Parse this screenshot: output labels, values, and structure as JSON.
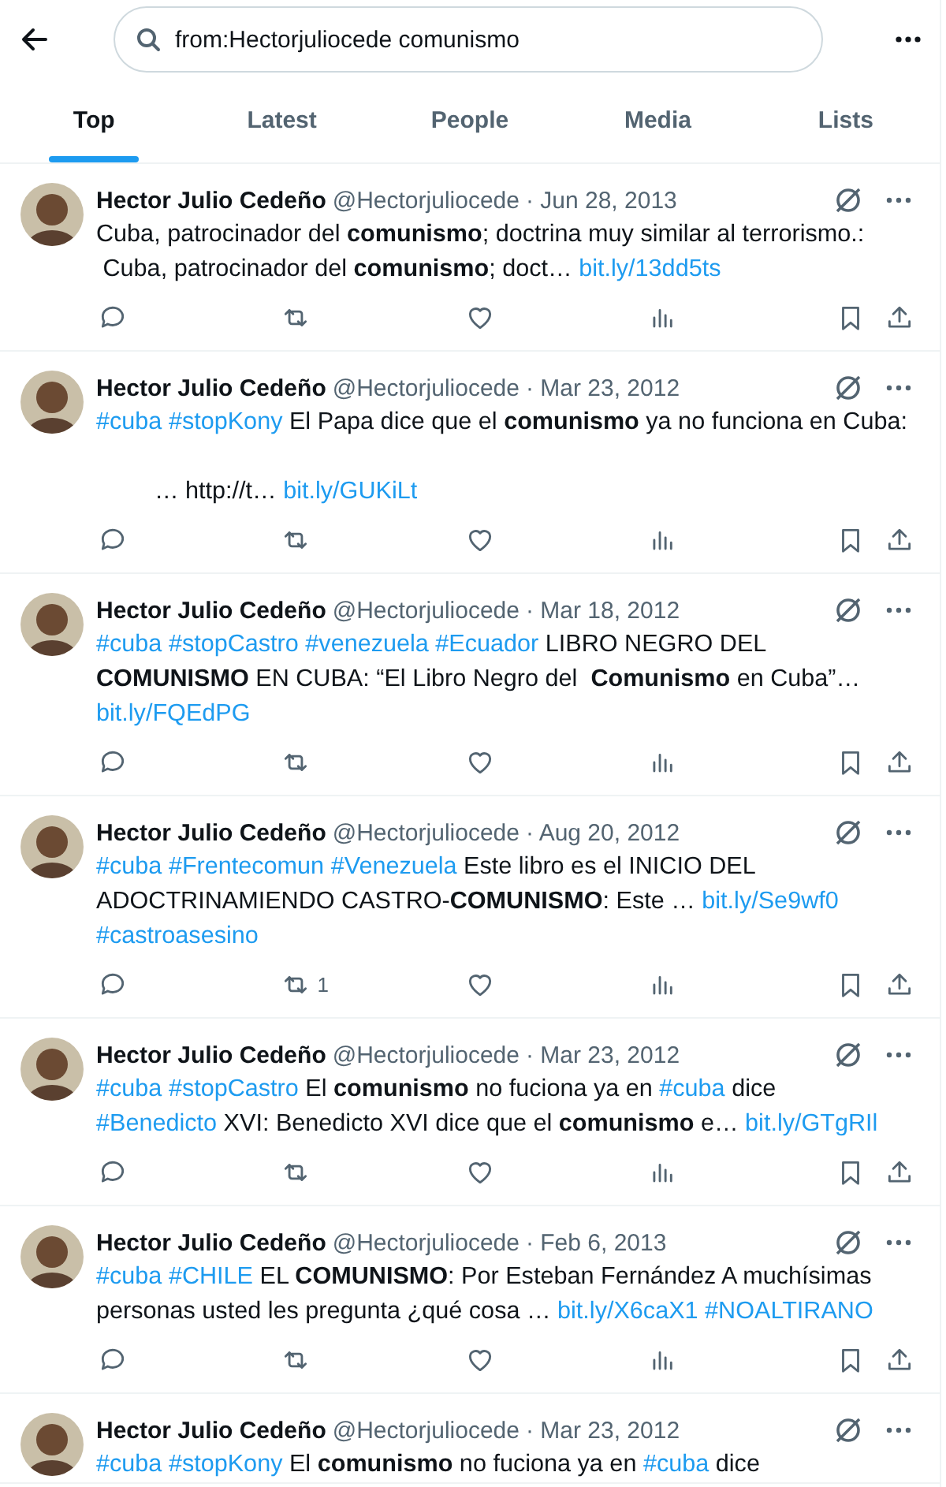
{
  "search": {
    "value": "from:Hectorjuliocede comunismo"
  },
  "tabs": [
    {
      "label": "Top",
      "selected": true
    },
    {
      "label": "Latest",
      "selected": false
    },
    {
      "label": "People",
      "selected": false
    },
    {
      "label": "Media",
      "selected": false
    },
    {
      "label": "Lists",
      "selected": false
    }
  ],
  "tweets": [
    {
      "name": "Hector Julio Cedeño",
      "handle": "@Hectorjuliocede",
      "date": "· Jun 28, 2013",
      "lines": [
        {
          "segments": [
            {
              "kind": "text",
              "text": "Cuba, patrocinador del "
            },
            {
              "kind": "bold",
              "text": "comunismo"
            },
            {
              "kind": "text",
              "text": "; doctrina muy similar al terrorismo.:"
            }
          ]
        },
        {
          "segments": [
            {
              "kind": "text",
              "text": " Cuba, patrocinador del "
            },
            {
              "kind": "bold",
              "text": "comunismo"
            },
            {
              "kind": "text",
              "text": "; doct… "
            },
            {
              "kind": "link",
              "text": "bit.ly/13dd5ts"
            }
          ]
        }
      ]
    },
    {
      "name": "Hector Julio Cedeño",
      "handle": "@Hectorjuliocede",
      "date": "· Mar 23, 2012",
      "lines": [
        {
          "segments": [
            {
              "kind": "link",
              "text": "#cuba"
            },
            {
              "kind": "link",
              "text": "#stopKony"
            },
            {
              "kind": "text",
              "text": " El Papa dice que el "
            },
            {
              "kind": "bold",
              "text": "comunismo"
            },
            {
              "kind": "text",
              "text": " ya no funciona en Cuba:"
            }
          ]
        },
        {
          "gap_before": true,
          "indent": true,
          "segments": [
            {
              "kind": "text",
              "text": "… http://t… "
            },
            {
              "kind": "link",
              "text": "bit.ly/GUKiLt"
            }
          ]
        }
      ]
    },
    {
      "name": "Hector Julio Cedeño",
      "handle": "@Hectorjuliocede",
      "date": "· Mar 18, 2012",
      "lines": [
        {
          "segments": [
            {
              "kind": "link",
              "text": "#cuba"
            },
            {
              "kind": "link",
              "text": "#stopCastro"
            },
            {
              "kind": "link",
              "text": "#venezuela"
            },
            {
              "kind": "link",
              "text": "#Ecuador"
            },
            {
              "kind": "text",
              "text": " LIBRO NEGRO DEL"
            }
          ]
        },
        {
          "segments": [
            {
              "kind": "bold",
              "text": "COMUNISMO"
            },
            {
              "kind": "text",
              "text": " EN CUBA: “El Libro Negro del  "
            },
            {
              "kind": "bold",
              "text": "Comunismo"
            },
            {
              "kind": "text",
              "text": " en Cuba”…"
            }
          ]
        },
        {
          "segments": [
            {
              "kind": "link",
              "text": "bit.ly/FQEdPG"
            }
          ]
        }
      ]
    },
    {
      "name": "Hector Julio Cedeño",
      "handle": "@Hectorjuliocede",
      "date": "· Aug 20, 2012",
      "lines": [
        {
          "segments": [
            {
              "kind": "link",
              "text": "#cuba"
            },
            {
              "kind": "link",
              "text": "#Frentecomun"
            },
            {
              "kind": "link",
              "text": "#Venezuela"
            },
            {
              "kind": "text",
              "text": " Este libro es el INICIO DEL"
            }
          ]
        },
        {
          "segments": [
            {
              "kind": "text",
              "text": "ADOCTRINAMIENDO CASTRO-"
            },
            {
              "kind": "bold",
              "text": "COMUNISMO"
            },
            {
              "kind": "text",
              "text": ": Este … "
            },
            {
              "kind": "link",
              "text": "bit.ly/Se9wf0"
            }
          ]
        },
        {
          "segments": [
            {
              "kind": "link",
              "text": "#castroasesino"
            }
          ]
        }
      ],
      "retweets": "1"
    },
    {
      "name": "Hector Julio Cedeño",
      "handle": "@Hectorjuliocede",
      "date": "· Mar 23, 2012",
      "lines": [
        {
          "segments": [
            {
              "kind": "link",
              "text": "#cuba"
            },
            {
              "kind": "link",
              "text": "#stopCastro"
            },
            {
              "kind": "text",
              "text": " El "
            },
            {
              "kind": "bold",
              "text": "comunismo"
            },
            {
              "kind": "text",
              "text": " no fuciona ya en "
            },
            {
              "kind": "link",
              "text": "#cuba"
            },
            {
              "kind": "text",
              "text": " dice"
            }
          ]
        },
        {
          "segments": [
            {
              "kind": "link",
              "text": "#Benedicto"
            },
            {
              "kind": "text",
              "text": " XVI: Benedicto XVI dice que el "
            },
            {
              "kind": "bold",
              "text": "comunismo"
            },
            {
              "kind": "text",
              "text": " e… "
            },
            {
              "kind": "link",
              "text": "bit.ly/GTgRIl"
            }
          ]
        }
      ]
    },
    {
      "name": "Hector Julio Cedeño",
      "handle": "@Hectorjuliocede",
      "date": "· Feb 6, 2013",
      "lines": [
        {
          "segments": [
            {
              "kind": "link",
              "text": "#cuba"
            },
            {
              "kind": "link",
              "text": "#CHILE"
            },
            {
              "kind": "text",
              "text": " EL "
            },
            {
              "kind": "bold",
              "text": "COMUNISMO"
            },
            {
              "kind": "text",
              "text": ": Por Esteban Fernández A muchísimas"
            }
          ]
        },
        {
          "segments": [
            {
              "kind": "text",
              "text": "personas usted les pregunta ¿qué cosa … "
            },
            {
              "kind": "link",
              "text": "bit.ly/X6caX1"
            },
            {
              "kind": "link",
              "text": "#NOALTIRANO"
            }
          ]
        }
      ]
    },
    {
      "name": "Hector Julio Cedeño",
      "handle": "@Hectorjuliocede",
      "date": "· Mar 23, 2012",
      "lines": [
        {
          "segments": [
            {
              "kind": "link",
              "text": "#cuba"
            },
            {
              "kind": "link",
              "text": "#stopKony"
            },
            {
              "kind": "text",
              "text": " El "
            },
            {
              "kind": "bold",
              "text": "comunismo"
            },
            {
              "kind": "text",
              "text": " no fuciona ya en "
            },
            {
              "kind": "link",
              "text": "#cuba"
            },
            {
              "kind": "text",
              "text": " dice"
            }
          ]
        }
      ]
    }
  ]
}
